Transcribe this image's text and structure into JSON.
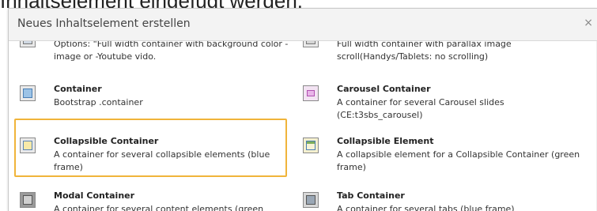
{
  "page": {
    "heading_text": "Inhaltselement eingefügt werden."
  },
  "modal": {
    "title": "Neues Inhaltselement erstellen",
    "close_label": "×"
  },
  "elements": [
    {
      "name": "",
      "desc": "Options: \"Full width container with background color -image or -Youtube vido.",
      "icon": "container-bg-icon"
    },
    {
      "name": "",
      "desc": "Full width container with parallax image scroll(Handys/Tablets: no scrolling)",
      "icon": "parallax-icon"
    },
    {
      "name": "Container",
      "desc": "Bootstrap .container",
      "icon": "container-icon"
    },
    {
      "name": "Carousel Container",
      "desc": "A container for several Carousel slides (CE:t3sbs_carousel)",
      "icon": "carousel-icon"
    },
    {
      "name": "Collapsible Container",
      "desc": "A container for several collapsible elements (blue frame)",
      "icon": "collapsible-container-icon"
    },
    {
      "name": "Collapsible Element",
      "desc": "A collapsible element for a Collapsible Container (green frame)",
      "icon": "collapsible-element-icon"
    },
    {
      "name": "Modal Container",
      "desc": "A container for several content elements (green",
      "icon": "modal-container-icon"
    },
    {
      "name": "Tab Container",
      "desc": "A container for several tabs (blue frame)",
      "icon": "tab-container-icon"
    }
  ],
  "colors": {
    "highlight": "#f0b43a",
    "header_bg": "#f3f3f3"
  }
}
